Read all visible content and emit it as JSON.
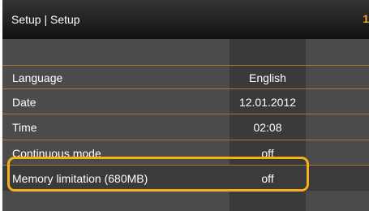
{
  "header": {
    "title": "Setup | Setup",
    "page_number": "1"
  },
  "settings": [
    {
      "label": "Language",
      "value": "English"
    },
    {
      "label": "Date",
      "value": "12.01.2012"
    },
    {
      "label": "Time",
      "value": "02:08"
    },
    {
      "label": "Continuous mode",
      "value": "off"
    },
    {
      "label": "Memory limitation (680MB)",
      "value": "off"
    }
  ],
  "colors": {
    "accent": "#f4b118",
    "row_divider": "#a37a2e",
    "background": "#4b4b4b"
  }
}
